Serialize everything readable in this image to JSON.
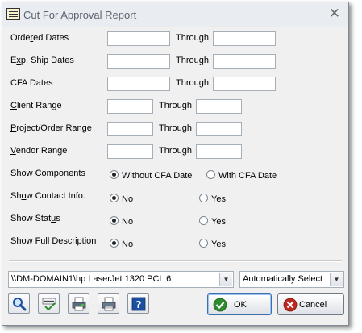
{
  "window": {
    "title": "Cut For Approval Report",
    "close_glyph": "✕"
  },
  "fields": {
    "ordered_dates": {
      "label": "Ordered Dates",
      "through": "Through"
    },
    "exp_ship_dates": {
      "label": "Exp. Ship Dates",
      "through": "Through"
    },
    "cfa_dates": {
      "label": "CFA Dates",
      "through": "Through"
    },
    "client_range": {
      "label": "Client Range",
      "through": "Through"
    },
    "project_order_range": {
      "label": "Project/Order Range",
      "through": "Through"
    },
    "vendor_range": {
      "label": "Vendor Range",
      "through": "Through"
    }
  },
  "options": {
    "show_components": {
      "label": "Show Components",
      "opt1": "Without CFA Date",
      "opt2": "With CFA Date",
      "selected": 1
    },
    "show_contact_info": {
      "label": "Show Contact Info.",
      "opt1": "No",
      "opt2": "Yes",
      "selected": 1
    },
    "show_status": {
      "label": "Show Status",
      "opt1": "No",
      "opt2": "Yes",
      "selected": 1
    },
    "show_full_description": {
      "label": "Show Full Description",
      "opt1": "No",
      "opt2": "Yes",
      "selected": 1
    }
  },
  "printer": {
    "value": "\\\\DM-DOMAIN1\\hp LaserJet 1320 PCL 6"
  },
  "tray": {
    "value": "Automatically Select"
  },
  "buttons": {
    "ok": "OK",
    "cancel": "Cancel"
  },
  "icons": [
    "search-icon",
    "spell-check-icon",
    "print-preview-icon",
    "printer-setup-icon",
    "help-icon",
    "ok-check-icon",
    "cancel-x-icon"
  ],
  "colors": {
    "ok_green": "#2e8b2e",
    "cancel_red": "#c0281f",
    "help_blue": "#1d4fa0"
  }
}
